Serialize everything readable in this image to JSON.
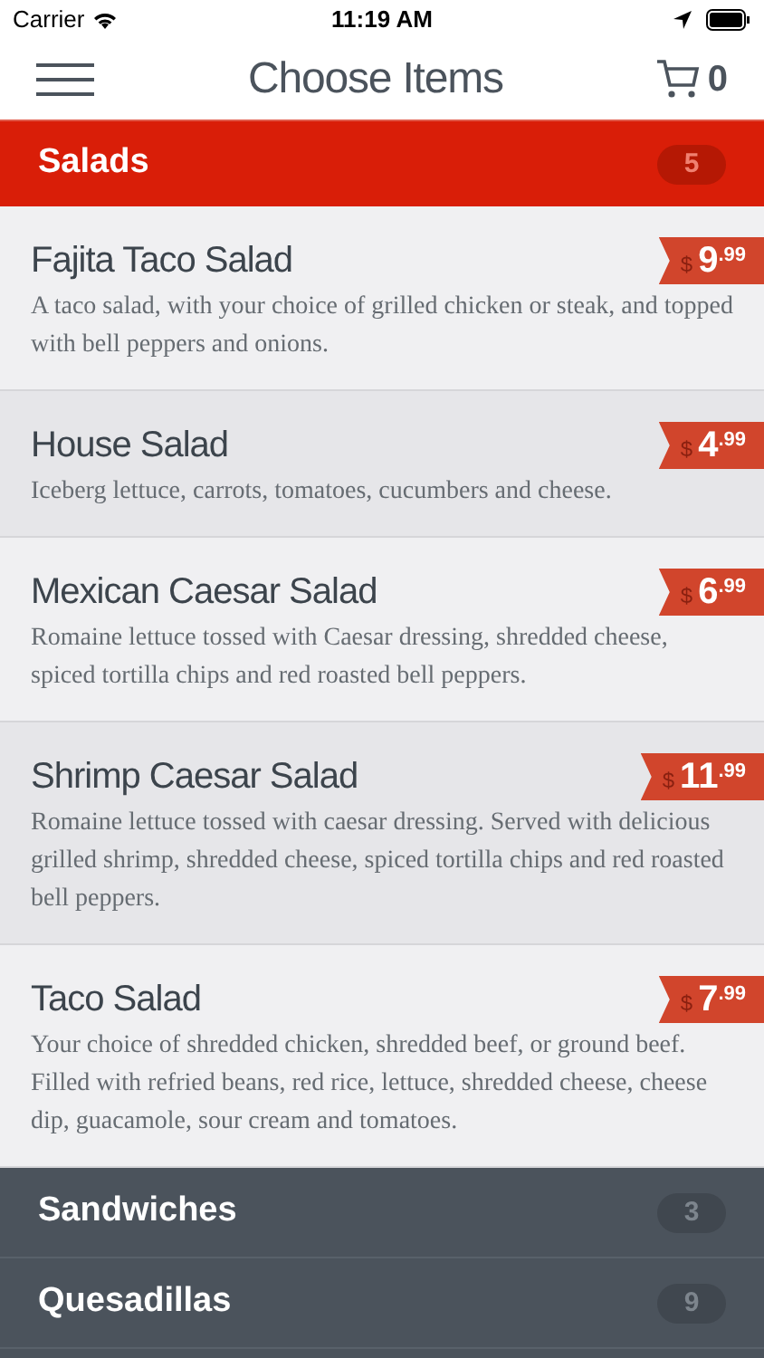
{
  "status_bar": {
    "carrier": "Carrier",
    "time": "11:19 AM"
  },
  "nav": {
    "title": "Choose Items",
    "cart_count": "0"
  },
  "categories": [
    {
      "name": "Salads",
      "count": "5",
      "expanded": true,
      "items": [
        {
          "name": "Fajita Taco Salad",
          "description": "A taco salad, with your choice of grilled chicken or steak, and topped with bell peppers and onions.",
          "price": {
            "currency": "$",
            "dollars": "9",
            "cents": ".99"
          }
        },
        {
          "name": "House Salad",
          "description": "Iceberg lettuce, carrots, tomatoes, cucumbers and cheese.",
          "price": {
            "currency": "$",
            "dollars": "4",
            "cents": ".99"
          }
        },
        {
          "name": "Mexican Caesar Salad",
          "description": "Romaine lettuce tossed with Caesar dressing, shredded cheese, spiced tortilla chips and red roasted bell peppers.",
          "price": {
            "currency": "$",
            "dollars": "6",
            "cents": ".99"
          }
        },
        {
          "name": "Shrimp Caesar Salad",
          "description": "Romaine lettuce tossed with caesar dressing. Served with delicious grilled shrimp, shredded cheese, spiced tortilla chips and red roasted bell peppers.",
          "price": {
            "currency": "$",
            "dollars": "11",
            "cents": ".99"
          }
        },
        {
          "name": "Taco Salad",
          "description": "Your choice of shredded chicken, shredded beef, or ground beef. Filled with refried beans, red rice, lettuce, shredded cheese, cheese dip, guacamole, sour cream and tomatoes.",
          "price": {
            "currency": "$",
            "dollars": "7",
            "cents": ".99"
          }
        }
      ]
    },
    {
      "name": "Sandwiches",
      "count": "3",
      "expanded": false
    },
    {
      "name": "Quesadillas",
      "count": "9",
      "expanded": false
    }
  ]
}
